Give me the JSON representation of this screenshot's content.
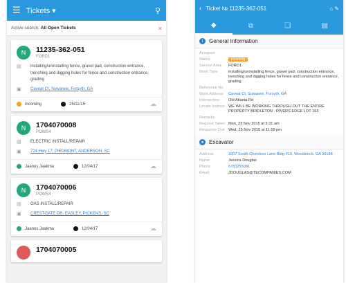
{
  "left": {
    "header": {
      "title": "Tickets ▾",
      "menu_icon": "☰",
      "search_icon": "⚲"
    },
    "active_search": {
      "label": "Active search:",
      "value": "All Open Tickets",
      "clear": "×"
    },
    "tickets": [
      {
        "avatar": "N",
        "number": "11235-362-051",
        "code": "FORD1",
        "description": "installing/uninstalling fence, gravel pad, construction entrance, trenching and digging holes for fence and construction entrance, grading",
        "address": "Caveat Ct, Suwanee, Forsyth, GA",
        "status": "incoming",
        "status_color": "#f5a623",
        "date": "25/11/15"
      },
      {
        "avatar": "N",
        "number": "1704070008",
        "code": "POWS4",
        "description": "ELECTRIC INSTALL/REPAIR",
        "address": "724 Hwy 17, PIEDMONT, ANDERSON, SC",
        "status": "Jaanus Jaakma",
        "status_color": "#23a67a",
        "date": "12/04/17"
      },
      {
        "avatar": "N",
        "number": "1704070006",
        "code": "POWS4",
        "description": "GAS INSTALL/REPAIR",
        "address": "CRESTGATE DR, EASLEY, PICKENS, SC",
        "status": "Jaanus Jaakma",
        "status_color": "#23a67a",
        "date": "12/04/17"
      }
    ],
    "partial_ticket": {
      "number": "1704070005"
    }
  },
  "right": {
    "header": {
      "title": "Ticket № 11235-362-051",
      "back": "‹",
      "icons": "⌂ ✎"
    },
    "tabs": [
      "◆",
      "⧉",
      "❑",
      "▤"
    ],
    "general": {
      "title": "General Information",
      "rows": [
        {
          "k": "Assignee",
          "v": ""
        },
        {
          "k": "Status",
          "v": "incoming",
          "badge": true
        },
        {
          "k": "Service Area",
          "v": "FORD1"
        },
        {
          "k": "Work Type",
          "v": "installing/uninstalling fence, gravel pad, construction entrance, trenching and digging holes for fence and construction entrance, grading"
        },
        {
          "k": "Reference No",
          "v": ""
        },
        {
          "k": "Work Address",
          "v": "Caveat Ct, Suwanee, Forsyth, GA",
          "link": true
        },
        {
          "k": "Intersection",
          "v": "Old Atlanta Rd"
        },
        {
          "k": "Locate Instruct...",
          "v": "WE WILL BE WORKING THROUGH OUT THE ENTIRE PROPERTY BRIDLETON - RIVERS EDGE LOT 163"
        },
        {
          "k": "Remarks",
          "v": ""
        },
        {
          "k": "Request Taken",
          "v": "Mon, 23 Nov 2015 at 9:31 am"
        },
        {
          "k": "Response Due",
          "v": "Wed, 25 Nov 2015 at 11:59 pm"
        }
      ]
    },
    "excavator": {
      "title": "Excavator",
      "rows": [
        {
          "k": "Address",
          "v": "3207 South Cherokee Lane Bldg 410, Woodstock, GA 30188",
          "link": true
        },
        {
          "k": "Name",
          "v": "Jessica Douglas"
        },
        {
          "k": "Phone",
          "v": "6783255081",
          "link": true
        },
        {
          "k": "Email",
          "v": "JDOUGLAS@TECOMPANIES.COM"
        }
      ]
    }
  }
}
